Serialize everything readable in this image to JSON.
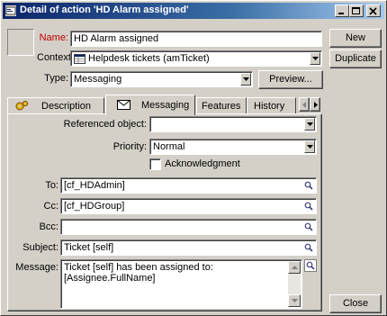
{
  "window": {
    "title": "Detail of action 'HD Alarm assigned'"
  },
  "form": {
    "name_label": "Name:",
    "name_value": "HD Alarm assigned",
    "context_label": "Context:",
    "context_value": "Helpdesk tickets (amTicket)",
    "type_label": "Type:",
    "type_value": "Messaging",
    "preview_label": "Preview..."
  },
  "buttons": {
    "new": "New",
    "duplicate": "Duplicate",
    "close": "Close"
  },
  "tabs": [
    {
      "label": "Description",
      "icon": "gears-icon",
      "active": false
    },
    {
      "label": "Messaging",
      "icon": "envelope-icon",
      "active": true
    },
    {
      "label": "Features",
      "active": false
    },
    {
      "label": "History",
      "active": false
    }
  ],
  "messaging": {
    "referenced_label": "Referenced object:",
    "referenced_value": "",
    "priority_label": "Priority:",
    "priority_value": "Normal",
    "ack_label": "Acknowledgment",
    "to_label": "To:",
    "to_value": "[cf_HDAdmin]",
    "cc_label": "Cc:",
    "cc_value": "[cf_HDGroup]",
    "bcc_label": "Bcc:",
    "bcc_value": "",
    "subject_label": "Subject:",
    "subject_value": "Ticket [self]",
    "message_label": "Message:",
    "message_line1": "Ticket [self] has been assigned to:",
    "message_line2": "[Assignee.FullName]"
  },
  "colors": {
    "required_label": "#c00000",
    "title_bar": "#0a246a",
    "face": "#d4d0c8"
  }
}
